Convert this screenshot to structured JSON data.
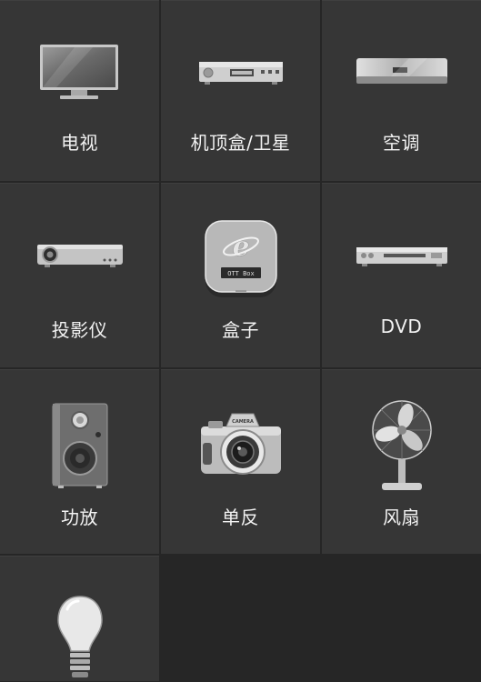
{
  "devices": [
    {
      "label": "电视",
      "icon": "tv-icon"
    },
    {
      "label": "机顶盒/卫星",
      "icon": "set-top-box-icon"
    },
    {
      "label": "空调",
      "icon": "air-conditioner-icon"
    },
    {
      "label": "投影仪",
      "icon": "projector-icon"
    },
    {
      "label": "盒子",
      "icon": "ott-box-icon",
      "icon_text": "OTT Box"
    },
    {
      "label": "DVD",
      "icon": "dvd-player-icon"
    },
    {
      "label": "功放",
      "icon": "speaker-icon"
    },
    {
      "label": "单反",
      "icon": "camera-icon",
      "icon_text": "CAMERA"
    },
    {
      "label": "风扇",
      "icon": "fan-icon"
    },
    {
      "label": "",
      "icon": "light-bulb-icon"
    }
  ],
  "colors": {
    "background": "#262626",
    "tile": "#363636",
    "label": "#f2f2f2"
  }
}
